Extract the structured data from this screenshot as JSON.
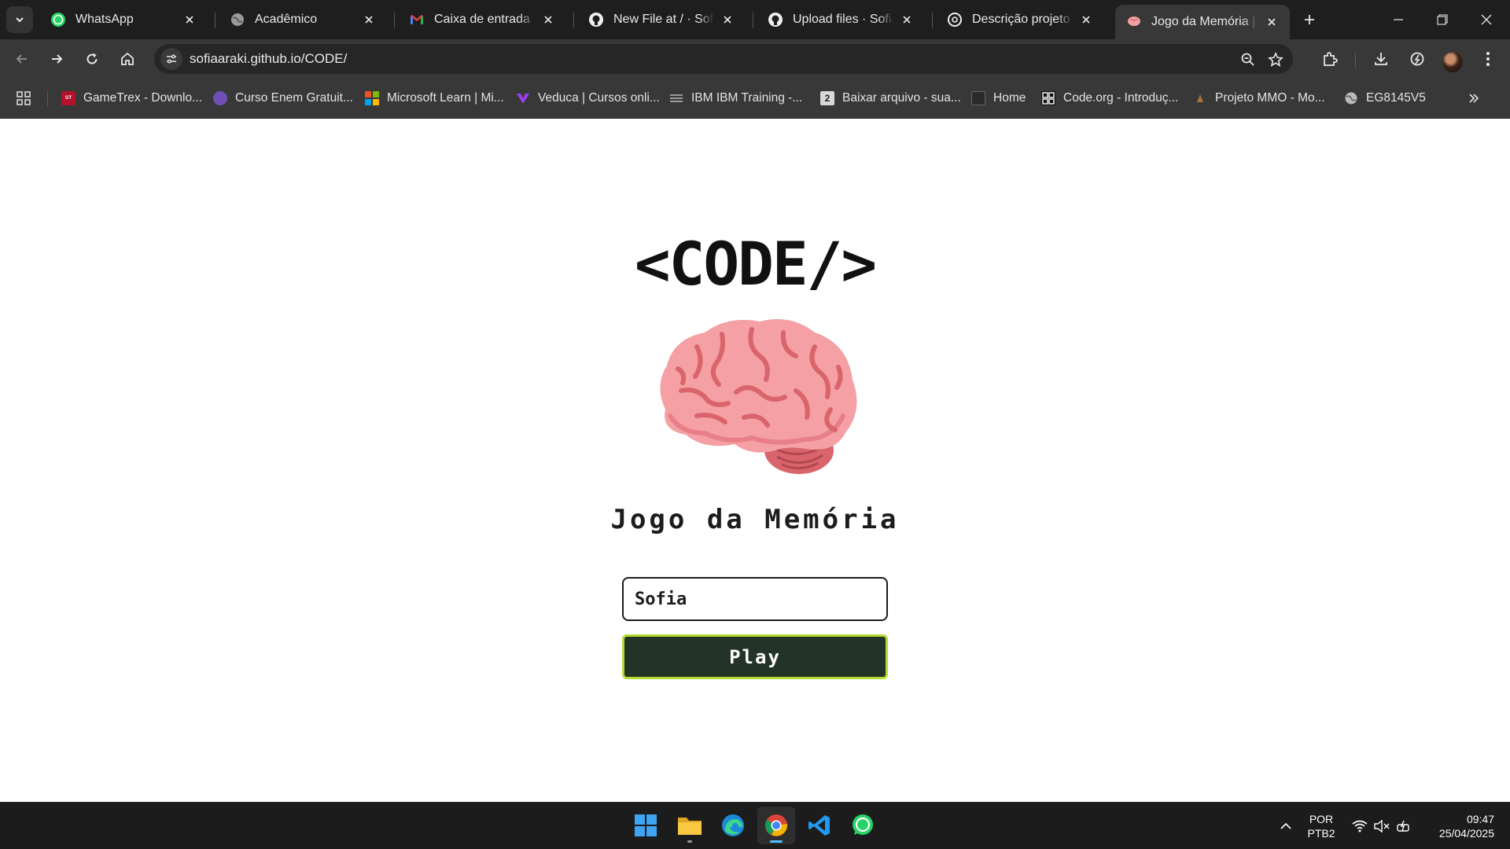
{
  "browser": {
    "tabs": [
      {
        "title": "WhatsApp",
        "icon": "whatsapp-icon",
        "active": false
      },
      {
        "title": "Acadêmico",
        "icon": "globe-icon",
        "active": false
      },
      {
        "title": "Caixa de entrada - sofia",
        "icon": "gmail-icon",
        "active": false
      },
      {
        "title": "New File at / · SofiaAraki",
        "icon": "github-icon",
        "active": false
      },
      {
        "title": "Upload files · SofiaAraki",
        "icon": "github-icon",
        "active": false
      },
      {
        "title": "Descrição projeto scrum",
        "icon": "chatgpt-icon",
        "active": false
      },
      {
        "title": "Jogo da Memória | Login",
        "icon": "brain-icon",
        "active": true
      }
    ],
    "url": "sofiaaraki.github.io/CODE/",
    "bookmarks": [
      {
        "label": "GameTrex - Downlo...",
        "icon": "gametrex-icon",
        "color": "#b3122a"
      },
      {
        "label": "Curso Enem Gratuit...",
        "icon": "enem-icon",
        "color": "#6f4fb6"
      },
      {
        "label": "Microsoft Learn | Mi...",
        "icon": "microsoft-icon",
        "color": "#f25022"
      },
      {
        "label": "Veduca | Cursos onli...",
        "icon": "veduca-icon",
        "color": "#7d2fd0"
      },
      {
        "label": "IBM IBM Training -...",
        "icon": "ibm-icon",
        "color": "#6b6b6b"
      },
      {
        "label": "Baixar arquivo - sua...",
        "icon": "download-site-icon",
        "color": "#d9d9d9"
      },
      {
        "label": "Home",
        "icon": "home-site-icon",
        "color": "#2a2a2a"
      },
      {
        "label": "Code.org - Introduç...",
        "icon": "codeorg-icon",
        "color": "#111111"
      },
      {
        "label": "Projeto MMO - Mo...",
        "icon": "mmo-icon",
        "color": "#8a5a2a"
      },
      {
        "label": "EG8145V5",
        "icon": "globe-icon",
        "color": "#bbbbbb"
      }
    ]
  },
  "page": {
    "logo": "<CODE/>",
    "title": "Jogo da Memória",
    "name_value": "Sofia",
    "play_label": "Play",
    "accent": "#b5dc33",
    "button_bg": "#243328"
  },
  "taskbar": {
    "language": "POR",
    "keyboard": "PTB2",
    "time": "09:47",
    "date": "25/04/2025"
  }
}
